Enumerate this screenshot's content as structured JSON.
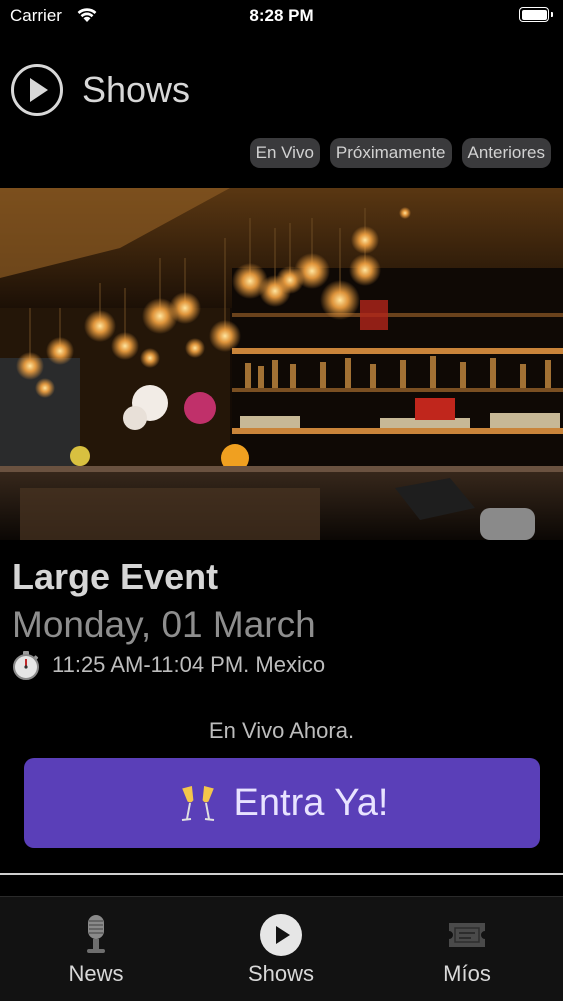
{
  "status_bar": {
    "carrier": "Carrier",
    "time": "8:28 PM"
  },
  "header": {
    "title": "Shows",
    "icon": "play-circle-icon"
  },
  "filters": [
    {
      "label": "En Vivo"
    },
    {
      "label": "Próximamente"
    },
    {
      "label": "Anteriores"
    }
  ],
  "event": {
    "image": "bar-interior-photo",
    "title": "Large Event",
    "date": "Monday, 01 March",
    "time": "11:25 AM-11:04 PM. Mexico",
    "time_icon": "stopwatch-icon",
    "status": "En Vivo Ahora.",
    "cta_label": "Entra Ya!",
    "cta_icon": "champagne-glasses-icon"
  },
  "tabbar": {
    "items": [
      {
        "label": "News",
        "icon": "microphone-icon"
      },
      {
        "label": "Shows",
        "icon": "play-circle-icon",
        "active": true
      },
      {
        "label": "Míos",
        "icon": "ticket-icon"
      }
    ]
  },
  "colors": {
    "accent": "#5a3fb8",
    "background": "#000000",
    "tab_pill": "#3a3a3c"
  }
}
